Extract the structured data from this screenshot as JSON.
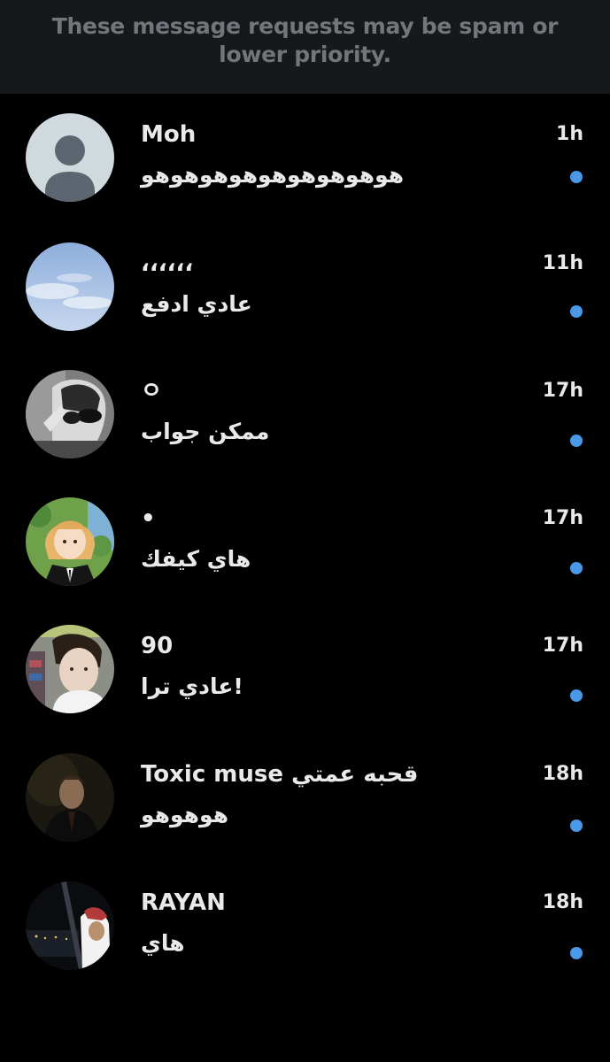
{
  "banner": {
    "text": "These message requests may be spam or lower priority."
  },
  "colors": {
    "background": "#000000",
    "banner_background": "#16181c",
    "banner_text": "#71767b",
    "primary_text": "#e7e9ea",
    "unread_dot": "#4a99e9"
  },
  "requests": [
    {
      "name": "Moh",
      "message": "هوهوهوهوهوهوهوهوهو",
      "time": "1h",
      "unread": true,
      "avatar": "default-avatar"
    },
    {
      "name": "،،،،،،",
      "message": "عادي ادفع",
      "time": "11h",
      "unread": true,
      "avatar": "sky-avatar"
    },
    {
      "name": "ㅇ",
      "message": "ممكن جواب",
      "time": "17h",
      "unread": true,
      "avatar": "sunglasses-photo-avatar"
    },
    {
      "name": "•",
      "message": "هاي كيفك",
      "time": "17h",
      "unread": true,
      "avatar": "anime-avatar"
    },
    {
      "name": "90",
      "message": "عادي ترا!",
      "time": "17h",
      "unread": true,
      "avatar": "selfie-photo-avatar"
    },
    {
      "name": "Toxic muse قحبه عمتي",
      "message": "هوهوهو",
      "time": "18h",
      "unread": true,
      "avatar": "dark-portrait-avatar"
    },
    {
      "name": "RAYAN",
      "message": "هاي",
      "time": "18h",
      "unread": true,
      "avatar": "night-photo-avatar"
    }
  ]
}
